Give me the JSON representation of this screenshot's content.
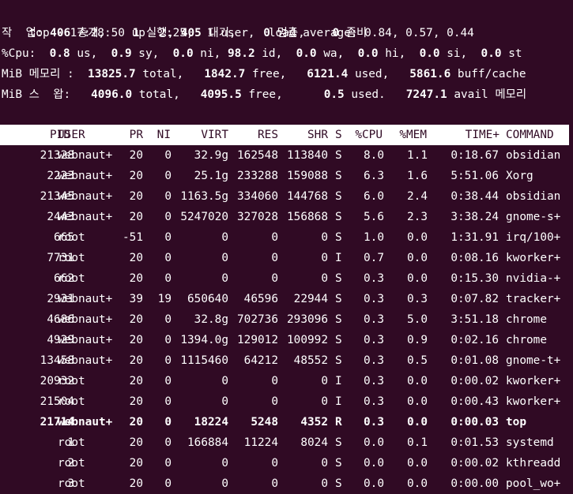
{
  "window": {
    "title": "top"
  },
  "summary": {
    "line1": "top - 17:28:50 up  2:25,  1 user,  load average: 0.84, 0.57, 0.44",
    "tasks": {
      "label": "작  업:",
      "total": "406",
      "total_label": "총계,",
      "running": "1",
      "running_label": "실행,",
      "sleeping": "405",
      "sleeping_label": "대기,",
      "stopped": "0",
      "stopped_label": "멈춤,",
      "zombie": "0",
      "zombie_label": "좀비"
    },
    "cpu": {
      "label": "%Cpu:",
      "us": "0.8",
      "sy": "0.9",
      "ni": "0.0",
      "id": "98.2",
      "wa": "0.0",
      "hi": "0.0",
      "si": "0.0",
      "st": "0.0"
    },
    "mem": {
      "label": "MiB 메모리 :",
      "total": "13825.7",
      "free": "1842.7",
      "used": "6121.4",
      "buff_cache": "5861.6"
    },
    "swap": {
      "label": "MiB 스  왑:",
      "total": "4096.0",
      "free": "4095.5",
      "used": "0.5",
      "avail": "7247.1",
      "avail_label": "avail 메모리"
    }
  },
  "columns": [
    "PID",
    "USER",
    "PR",
    "NI",
    "VIRT",
    "RES",
    "SHR",
    "S",
    "%CPU",
    "%MEM",
    "TIME+",
    "COMMAND"
  ],
  "processes": [
    {
      "pid": "21328",
      "user": "webnaut+",
      "pr": "20",
      "ni": "0",
      "virt": "32.9g",
      "res": "162548",
      "shr": "113840",
      "s": "S",
      "cpu": "8.0",
      "mem": "1.1",
      "time": "0:18.67",
      "cmd": "obsidian",
      "bold": false
    },
    {
      "pid": "2223",
      "user": "webnaut+",
      "pr": "20",
      "ni": "0",
      "virt": "25.1g",
      "res": "233288",
      "shr": "159088",
      "s": "S",
      "cpu": "6.3",
      "mem": "1.6",
      "time": "5:51.06",
      "cmd": "Xorg",
      "bold": false
    },
    {
      "pid": "21345",
      "user": "webnaut+",
      "pr": "20",
      "ni": "0",
      "virt": "1163.5g",
      "res": "334060",
      "shr": "144768",
      "s": "S",
      "cpu": "6.0",
      "mem": "2.4",
      "time": "0:38.44",
      "cmd": "obsidian",
      "bold": false
    },
    {
      "pid": "2443",
      "user": "webnaut+",
      "pr": "20",
      "ni": "0",
      "virt": "5247020",
      "res": "327028",
      "shr": "156868",
      "s": "S",
      "cpu": "5.6",
      "mem": "2.3",
      "time": "3:38.24",
      "cmd": "gnome-s+",
      "bold": false
    },
    {
      "pid": "665",
      "user": "root",
      "pr": "-51",
      "ni": "0",
      "virt": "0",
      "res": "0",
      "shr": "0",
      "s": "S",
      "cpu": "1.0",
      "mem": "0.0",
      "time": "1:31.91",
      "cmd": "irq/100+",
      "bold": false
    },
    {
      "pid": "7731",
      "user": "root",
      "pr": "20",
      "ni": "0",
      "virt": "0",
      "res": "0",
      "shr": "0",
      "s": "I",
      "cpu": "0.7",
      "mem": "0.0",
      "time": "0:08.16",
      "cmd": "kworker+",
      "bold": false
    },
    {
      "pid": "662",
      "user": "root",
      "pr": "20",
      "ni": "0",
      "virt": "0",
      "res": "0",
      "shr": "0",
      "s": "S",
      "cpu": "0.3",
      "mem": "0.0",
      "time": "0:15.30",
      "cmd": "nvidia-+",
      "bold": false
    },
    {
      "pid": "2931",
      "user": "webnaut+",
      "pr": "39",
      "ni": "19",
      "virt": "650640",
      "res": "46596",
      "shr": "22944",
      "s": "S",
      "cpu": "0.3",
      "mem": "0.3",
      "time": "0:07.82",
      "cmd": "tracker+",
      "bold": false
    },
    {
      "pid": "4686",
      "user": "webnaut+",
      "pr": "20",
      "ni": "0",
      "virt": "32.8g",
      "res": "702736",
      "shr": "293096",
      "s": "S",
      "cpu": "0.3",
      "mem": "5.0",
      "time": "3:51.18",
      "cmd": "chrome",
      "bold": false
    },
    {
      "pid": "4929",
      "user": "webnaut+",
      "pr": "20",
      "ni": "0",
      "virt": "1394.0g",
      "res": "129012",
      "shr": "100992",
      "s": "S",
      "cpu": "0.3",
      "mem": "0.9",
      "time": "0:02.16",
      "cmd": "chrome",
      "bold": false
    },
    {
      "pid": "13458",
      "user": "webnaut+",
      "pr": "20",
      "ni": "0",
      "virt": "1115460",
      "res": "64212",
      "shr": "48552",
      "s": "S",
      "cpu": "0.3",
      "mem": "0.5",
      "time": "0:01.08",
      "cmd": "gnome-t+",
      "bold": false
    },
    {
      "pid": "20932",
      "user": "root",
      "pr": "20",
      "ni": "0",
      "virt": "0",
      "res": "0",
      "shr": "0",
      "s": "I",
      "cpu": "0.3",
      "mem": "0.0",
      "time": "0:00.02",
      "cmd": "kworker+",
      "bold": false
    },
    {
      "pid": "21504",
      "user": "root",
      "pr": "20",
      "ni": "0",
      "virt": "0",
      "res": "0",
      "shr": "0",
      "s": "I",
      "cpu": "0.3",
      "mem": "0.0",
      "time": "0:00.43",
      "cmd": "kworker+",
      "bold": false
    },
    {
      "pid": "21714",
      "user": "webnaut+",
      "pr": "20",
      "ni": "0",
      "virt": "18224",
      "res": "5248",
      "shr": "4352",
      "s": "R",
      "cpu": "0.3",
      "mem": "0.0",
      "time": "0:00.03",
      "cmd": "top",
      "bold": true
    },
    {
      "pid": "1",
      "user": "root",
      "pr": "20",
      "ni": "0",
      "virt": "166884",
      "res": "11224",
      "shr": "8024",
      "s": "S",
      "cpu": "0.0",
      "mem": "0.1",
      "time": "0:01.53",
      "cmd": "systemd",
      "bold": false
    },
    {
      "pid": "2",
      "user": "root",
      "pr": "20",
      "ni": "0",
      "virt": "0",
      "res": "0",
      "shr": "0",
      "s": "S",
      "cpu": "0.0",
      "mem": "0.0",
      "time": "0:00.02",
      "cmd": "kthreadd",
      "bold": false
    },
    {
      "pid": "3",
      "user": "root",
      "pr": "20",
      "ni": "0",
      "virt": "0",
      "res": "0",
      "shr": "0",
      "s": "S",
      "cpu": "0.0",
      "mem": "0.0",
      "time": "0:00.00",
      "cmd": "pool_wo+",
      "bold": false
    }
  ],
  "colors": {
    "background": "#300a24",
    "foreground": "#ffffff"
  }
}
